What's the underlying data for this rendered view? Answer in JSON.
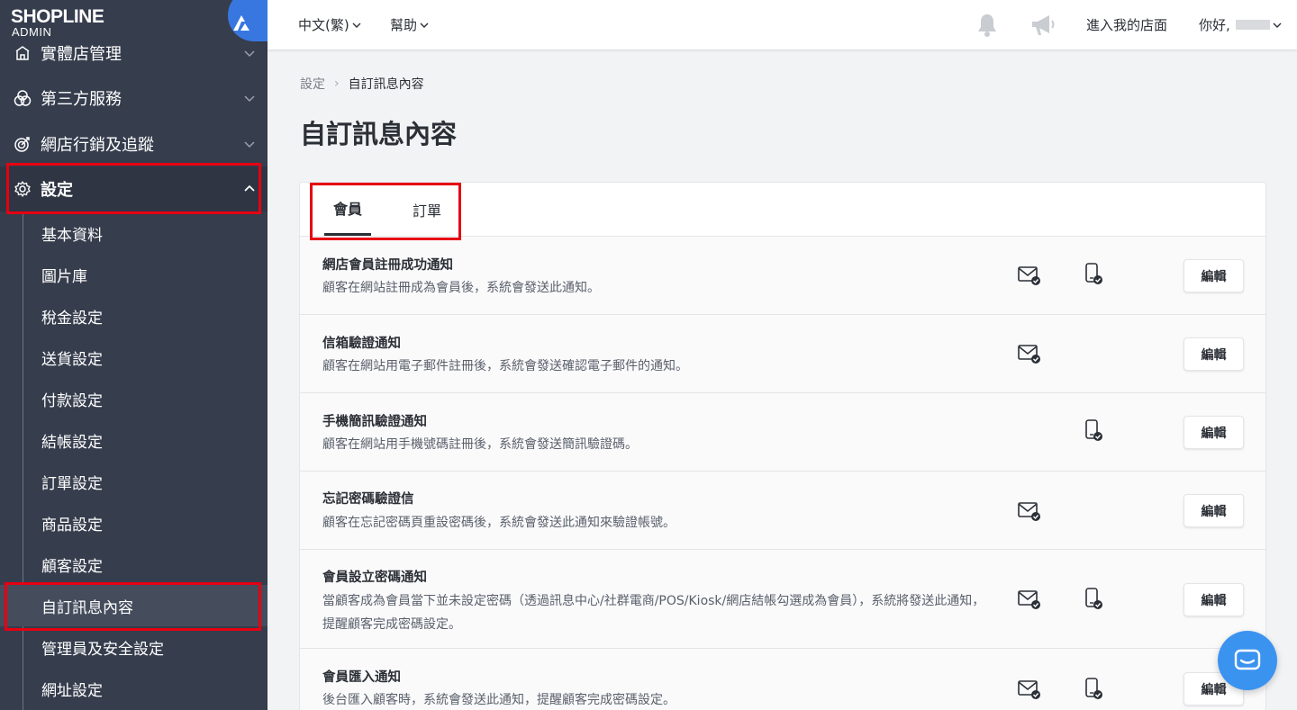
{
  "brand": {
    "name": "SHOPLINE",
    "sub": "ADMIN"
  },
  "sidebar": {
    "top_items": [
      {
        "label": "實體店管理",
        "icon": "store-icon"
      },
      {
        "label": "第三方服務",
        "icon": "apps-icon"
      },
      {
        "label": "網店行銷及追蹤",
        "icon": "target-icon"
      },
      {
        "label": "設定",
        "icon": "gear-icon"
      }
    ],
    "sub_items": [
      {
        "label": "基本資料"
      },
      {
        "label": "圖片庫"
      },
      {
        "label": "稅金設定"
      },
      {
        "label": "送貨設定"
      },
      {
        "label": "付款設定"
      },
      {
        "label": "結帳設定"
      },
      {
        "label": "訂單設定"
      },
      {
        "label": "商品設定"
      },
      {
        "label": "顧客設定"
      },
      {
        "label": "自訂訊息內容"
      },
      {
        "label": "管理員及安全設定"
      },
      {
        "label": "網址設定"
      }
    ]
  },
  "header": {
    "language": "中文(繁)",
    "help": "幫助",
    "store_link": "進入我的店面",
    "greeting": "你好,"
  },
  "breadcrumb": {
    "parent": "設定",
    "current": "自訂訊息內容"
  },
  "page_title": "自訂訊息內容",
  "tabs": [
    {
      "label": "會員"
    },
    {
      "label": "訂單"
    }
  ],
  "edit_label": "編輯",
  "rows": [
    {
      "title": "網店會員註冊成功通知",
      "desc": "顧客在網站註冊成為會員後，系統會發送此通知。"
    },
    {
      "title": "信箱驗證通知",
      "desc": "顧客在網站用電子郵件註冊後，系統會發送確認電子郵件的通知。"
    },
    {
      "title": "手機簡訊驗證通知",
      "desc": "顧客在網站用手機號碼註冊後，系統會發送簡訊驗證碼。"
    },
    {
      "title": "忘記密碼驗證信",
      "desc": "顧客在忘記密碼頁重設密碼後，系統會發送此通知來驗證帳號。"
    },
    {
      "title": "會員設立密碼通知",
      "desc": "當顧客成為會員當下並未設定密碼（透過訊息中心/社群電商/POS/Kiosk/網店結帳勾選成為會員），系統將發送此通知，提醒顧客完成密碼設定。"
    },
    {
      "title": "會員匯入通知",
      "desc": "後台匯入顧客時，系統會發送此通知，提醒顧客完成密碼設定。"
    }
  ],
  "colors": {
    "sidebar": "#363d4d",
    "accent": "#3877e0",
    "highlight": "#e60012",
    "chat": "#3b93f0"
  }
}
